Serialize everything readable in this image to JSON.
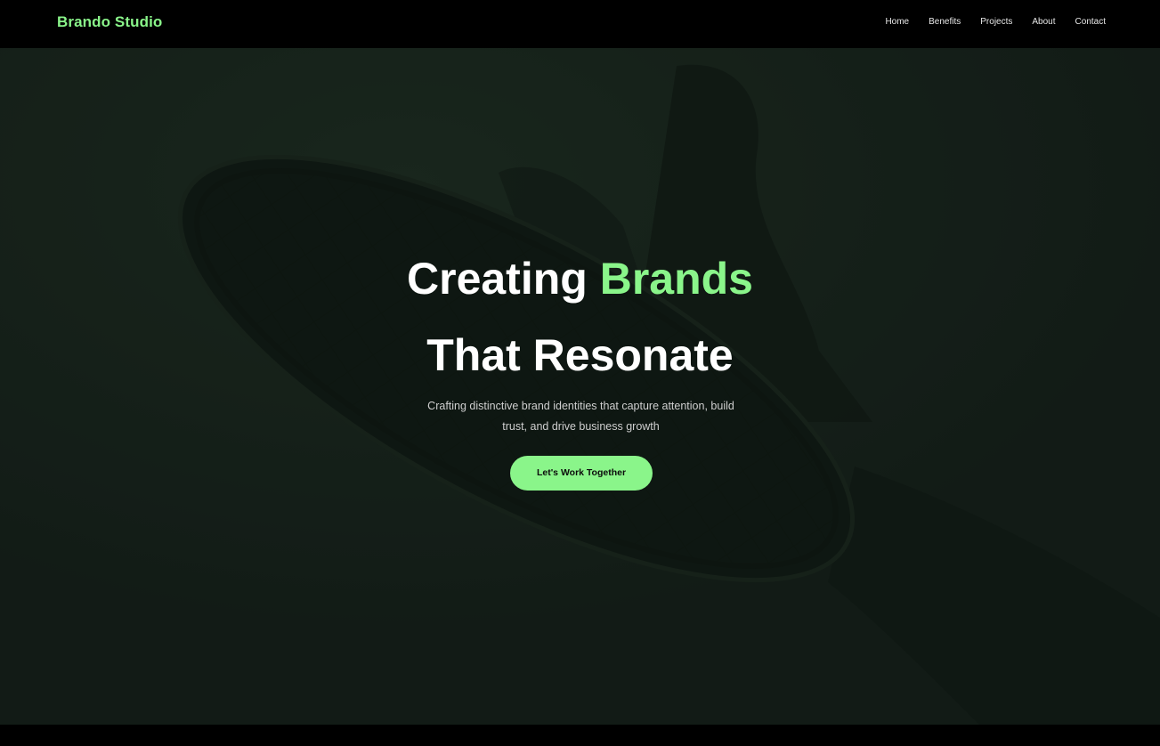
{
  "header": {
    "brand": "Brando Studio",
    "nav": [
      "Home",
      "Benefits",
      "Projects",
      "About",
      "Contact"
    ]
  },
  "hero": {
    "title_line1_part1": "Creating",
    "title_line1_accent": "Brands",
    "title_line2": "That Resonate",
    "subtitle": "Crafting distinctive brand identities that capture attention, build trust, and drive business growth",
    "cta_label": "Let's Work Together"
  },
  "colors": {
    "accent": "#8af58a",
    "background": "#000000",
    "hero_overlay": "#131c15"
  },
  "icons": [
    "shoe-sole-background-image"
  ]
}
